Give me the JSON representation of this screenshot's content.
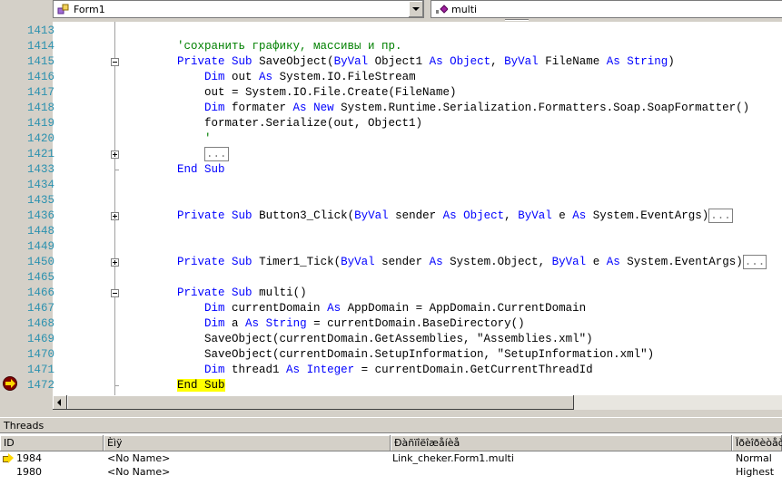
{
  "navbar": {
    "class_combo": "Form1",
    "member_combo": "multi"
  },
  "editor": {
    "lines": [
      {
        "num": "1413",
        "segments": []
      },
      {
        "num": "1414",
        "segments": [
          {
            "t": "    ",
            "c": ""
          },
          {
            "t": "'сохранить графику, массивы и пр.",
            "c": "cm"
          }
        ]
      },
      {
        "num": "1415",
        "segments": [
          {
            "t": "    ",
            "c": ""
          },
          {
            "t": "Private",
            "c": "kw"
          },
          {
            "t": " ",
            "c": ""
          },
          {
            "t": "Sub",
            "c": "kw"
          },
          {
            "t": " SaveObject(",
            "c": ""
          },
          {
            "t": "ByVal",
            "c": "kw"
          },
          {
            "t": " Object1 ",
            "c": ""
          },
          {
            "t": "As",
            "c": "kw"
          },
          {
            "t": " ",
            "c": ""
          },
          {
            "t": "Object",
            "c": "kw"
          },
          {
            "t": ", ",
            "c": ""
          },
          {
            "t": "ByVal",
            "c": "kw"
          },
          {
            "t": " FileName ",
            "c": ""
          },
          {
            "t": "As",
            "c": "kw"
          },
          {
            "t": " ",
            "c": ""
          },
          {
            "t": "String",
            "c": "kw"
          },
          {
            "t": ")",
            "c": ""
          }
        ]
      },
      {
        "num": "1416",
        "segments": [
          {
            "t": "        ",
            "c": ""
          },
          {
            "t": "Dim",
            "c": "kw"
          },
          {
            "t": " out ",
            "c": ""
          },
          {
            "t": "As",
            "c": "kw"
          },
          {
            "t": " System.IO.FileStream",
            "c": ""
          }
        ]
      },
      {
        "num": "1417",
        "segments": [
          {
            "t": "        out = System.IO.File.Create(FileName)",
            "c": ""
          }
        ]
      },
      {
        "num": "1418",
        "segments": [
          {
            "t": "        ",
            "c": ""
          },
          {
            "t": "Dim",
            "c": "kw"
          },
          {
            "t": " formater ",
            "c": ""
          },
          {
            "t": "As",
            "c": "kw"
          },
          {
            "t": " ",
            "c": ""
          },
          {
            "t": "New",
            "c": "kw"
          },
          {
            "t": " System.Runtime.Serialization.Formatters.Soap.SoapFormatter()",
            "c": ""
          }
        ]
      },
      {
        "num": "1419",
        "segments": [
          {
            "t": "        formater.Serialize(out, Object1)",
            "c": ""
          }
        ]
      },
      {
        "num": "1420",
        "segments": [
          {
            "t": "        ",
            "c": ""
          },
          {
            "t": "'",
            "c": "cm"
          }
        ]
      },
      {
        "num": "1421",
        "segments": [
          {
            "t": "        ",
            "c": ""
          },
          {
            "t": "...",
            "c": "collapsed"
          }
        ]
      },
      {
        "num": "1433",
        "segments": [
          {
            "t": "    ",
            "c": ""
          },
          {
            "t": "End",
            "c": "kw"
          },
          {
            "t": " ",
            "c": ""
          },
          {
            "t": "Sub",
            "c": "kw"
          }
        ]
      },
      {
        "num": "1434",
        "segments": []
      },
      {
        "num": "1435",
        "segments": []
      },
      {
        "num": "1436",
        "segments": [
          {
            "t": "    ",
            "c": ""
          },
          {
            "t": "Private",
            "c": "kw"
          },
          {
            "t": " ",
            "c": ""
          },
          {
            "t": "Sub",
            "c": "kw"
          },
          {
            "t": " Button3_Click(",
            "c": ""
          },
          {
            "t": "ByVal",
            "c": "kw"
          },
          {
            "t": " sender ",
            "c": ""
          },
          {
            "t": "As",
            "c": "kw"
          },
          {
            "t": " ",
            "c": ""
          },
          {
            "t": "Object",
            "c": "kw"
          },
          {
            "t": ", ",
            "c": ""
          },
          {
            "t": "ByVal",
            "c": "kw"
          },
          {
            "t": " e ",
            "c": ""
          },
          {
            "t": "As",
            "c": "kw"
          },
          {
            "t": " System.EventArgs)",
            "c": ""
          },
          {
            "t": "...",
            "c": "collapsed"
          }
        ]
      },
      {
        "num": "1448",
        "segments": []
      },
      {
        "num": "1449",
        "segments": []
      },
      {
        "num": "1450",
        "segments": [
          {
            "t": "    ",
            "c": ""
          },
          {
            "t": "Private",
            "c": "kw"
          },
          {
            "t": " ",
            "c": ""
          },
          {
            "t": "Sub",
            "c": "kw"
          },
          {
            "t": " Timer1_Tick(",
            "c": ""
          },
          {
            "t": "ByVal",
            "c": "kw"
          },
          {
            "t": " sender ",
            "c": ""
          },
          {
            "t": "As",
            "c": "kw"
          },
          {
            "t": " System.Object, ",
            "c": ""
          },
          {
            "t": "ByVal",
            "c": "kw"
          },
          {
            "t": " e ",
            "c": ""
          },
          {
            "t": "As",
            "c": "kw"
          },
          {
            "t": " System.EventArgs)",
            "c": ""
          },
          {
            "t": "...",
            "c": "collapsed"
          }
        ]
      },
      {
        "num": "1465",
        "segments": []
      },
      {
        "num": "1466",
        "segments": [
          {
            "t": "    ",
            "c": ""
          },
          {
            "t": "Private",
            "c": "kw"
          },
          {
            "t": " ",
            "c": ""
          },
          {
            "t": "Sub",
            "c": "kw"
          },
          {
            "t": " multi()",
            "c": ""
          }
        ]
      },
      {
        "num": "1467",
        "segments": [
          {
            "t": "        ",
            "c": ""
          },
          {
            "t": "Dim",
            "c": "kw"
          },
          {
            "t": " currentDomain ",
            "c": ""
          },
          {
            "t": "As",
            "c": "kw"
          },
          {
            "t": " AppDomain = AppDomain.CurrentDomain",
            "c": ""
          }
        ]
      },
      {
        "num": "1468",
        "segments": [
          {
            "t": "        ",
            "c": ""
          },
          {
            "t": "Dim",
            "c": "kw"
          },
          {
            "t": " a ",
            "c": ""
          },
          {
            "t": "As",
            "c": "kw"
          },
          {
            "t": " ",
            "c": ""
          },
          {
            "t": "String",
            "c": "kw"
          },
          {
            "t": " = currentDomain.BaseDirectory()",
            "c": ""
          }
        ]
      },
      {
        "num": "1469",
        "segments": [
          {
            "t": "        SaveObject(currentDomain.GetAssemblies, \"Assemblies.xml\")",
            "c": ""
          }
        ]
      },
      {
        "num": "1470",
        "segments": [
          {
            "t": "        SaveObject(currentDomain.SetupInformation, \"SetupInformation.xml\")",
            "c": ""
          }
        ]
      },
      {
        "num": "1471",
        "segments": [
          {
            "t": "        ",
            "c": ""
          },
          {
            "t": "Dim",
            "c": "kw"
          },
          {
            "t": " thread1 ",
            "c": ""
          },
          {
            "t": "As",
            "c": "kw"
          },
          {
            "t": " ",
            "c": ""
          },
          {
            "t": "Integer",
            "c": "kw"
          },
          {
            "t": " = currentDomain.GetCurrentThreadId",
            "c": ""
          }
        ]
      },
      {
        "num": "1472",
        "segments": [
          {
            "t": "    ",
            "c": ""
          },
          {
            "t": "End Sub",
            "c": "hl"
          }
        ]
      }
    ]
  },
  "threads": {
    "title": "Threads",
    "columns": [
      "ID",
      "Èìÿ",
      "Ðàñïîëîæåíèå",
      "Ïðèîðèòåò"
    ],
    "rows": [
      {
        "id": "1984",
        "name": "<No Name>",
        "location": "Link_cheker.Form1.multi",
        "priority": "Normal",
        "current": true
      },
      {
        "id": "1980",
        "name": "<No Name>",
        "location": "",
        "priority": "Highest",
        "current": false
      }
    ]
  }
}
